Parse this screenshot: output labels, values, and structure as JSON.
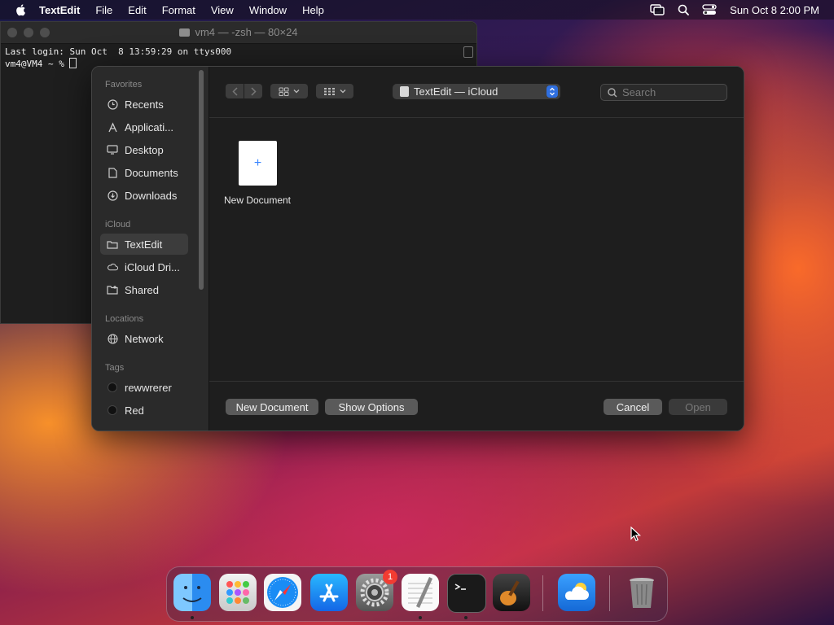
{
  "menubar": {
    "app_name": "TextEdit",
    "items": [
      "File",
      "Edit",
      "Format",
      "View",
      "Window",
      "Help"
    ],
    "datetime": "Sun Oct 8  2:00 PM"
  },
  "terminal": {
    "title": "vm4 — -zsh — 80×24",
    "line1": "Last login: Sun Oct  8 13:59:29 on ttys000",
    "line2": "vm4@VM4 ~ % "
  },
  "dialog": {
    "sidebar": {
      "favorites_heading": "Favorites",
      "favorites": [
        {
          "label": "Recents",
          "icon": "clock-icon"
        },
        {
          "label": "Applicati...",
          "icon": "applications-icon"
        },
        {
          "label": "Desktop",
          "icon": "desktop-icon"
        },
        {
          "label": "Documents",
          "icon": "document-icon"
        },
        {
          "label": "Downloads",
          "icon": "download-icon"
        }
      ],
      "icloud_heading": "iCloud",
      "icloud": [
        {
          "label": "TextEdit",
          "icon": "folder-icon",
          "selected": true
        },
        {
          "label": "iCloud Dri...",
          "icon": "cloud-icon"
        },
        {
          "label": "Shared",
          "icon": "shared-folder-icon"
        }
      ],
      "locations_heading": "Locations",
      "locations": [
        {
          "label": "Network",
          "icon": "globe-icon"
        }
      ],
      "tags_heading": "Tags",
      "tags": [
        {
          "label": "rewwrerer",
          "color": "#111111"
        },
        {
          "label": "Red",
          "color": "#111111"
        }
      ]
    },
    "location_popup": "TextEdit — iCloud",
    "search_placeholder": "Search",
    "new_document_tile": "New Document",
    "new_document_tile_glyph": "+",
    "buttons": {
      "new_document": "New Document",
      "show_options": "Show Options",
      "cancel": "Cancel",
      "open": "Open"
    }
  },
  "dock": {
    "apps": [
      "Finder",
      "Launchpad",
      "Safari",
      "App Store",
      "System Settings",
      "TextEdit",
      "Terminal",
      "GarageBand",
      "Weather",
      "Trash"
    ],
    "settings_badge": "1"
  },
  "colors": {
    "accent": "#2f6fe0",
    "badge": "#f23c32",
    "dialog_bg": "#1e1e1e",
    "sidebar_bg": "#2a2a2a"
  }
}
